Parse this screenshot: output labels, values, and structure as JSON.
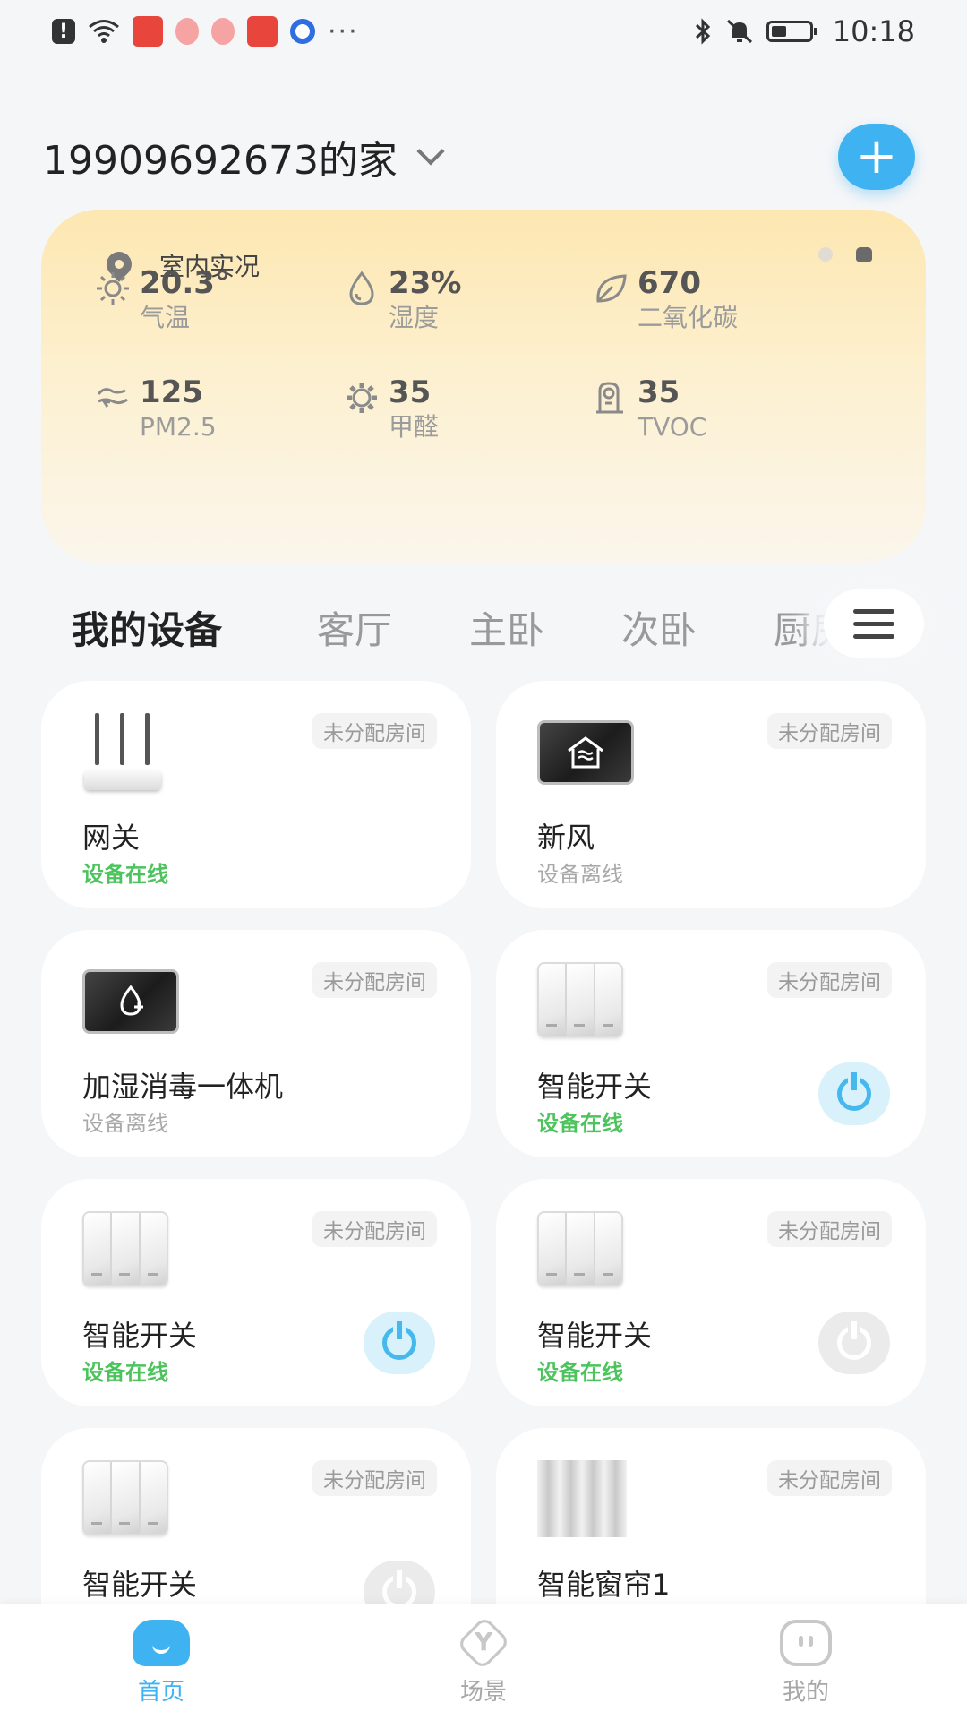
{
  "status_bar": {
    "time": "10:18",
    "more": "···",
    "icons": [
      "alert-icon",
      "wifi-icon",
      "app-icon",
      "app-icon",
      "app-icon",
      "app-icon",
      "app-icon",
      "bluetooth-icon",
      "mute-icon",
      "battery-icon"
    ]
  },
  "header": {
    "home_title": "19909692673的家",
    "add_label": "+"
  },
  "env": {
    "title": "室内实况",
    "metrics": [
      {
        "value": "20.3°",
        "label": "气温",
        "icon": "sun-icon"
      },
      {
        "value": "23%",
        "label": "湿度",
        "icon": "droplet-icon"
      },
      {
        "value": "670",
        "label": "二氧化碳",
        "icon": "leaf-icon"
      },
      {
        "value": "125",
        "label": "PM2.5",
        "icon": "wind-icon"
      },
      {
        "value": "35",
        "label": "甲醛",
        "icon": "gear-icon"
      },
      {
        "value": "35",
        "label": "TVOC",
        "icon": "sensor-icon"
      }
    ]
  },
  "tabs": [
    {
      "label": "我的设备",
      "active": true
    },
    {
      "label": "客厅"
    },
    {
      "label": "主卧"
    },
    {
      "label": "次卧"
    },
    {
      "label": "厨房"
    }
  ],
  "devices": [
    {
      "name": "网关",
      "status": "设备在线",
      "online": true,
      "room": "未分配房间",
      "image": "router",
      "power": null
    },
    {
      "name": "新风",
      "status": "设备离线",
      "online": false,
      "room": "未分配房间",
      "image": "fresh-air-panel",
      "power": null
    },
    {
      "name": "加湿消毒一体机",
      "status": "设备离线",
      "online": false,
      "room": "未分配房间",
      "image": "humidifier-panel",
      "power": null
    },
    {
      "name": "智能开关",
      "status": "设备在线",
      "online": true,
      "room": "未分配房间",
      "image": "switch",
      "power": "on"
    },
    {
      "name": "智能开关",
      "status": "设备在线",
      "online": true,
      "room": "未分配房间",
      "image": "switch",
      "power": "on"
    },
    {
      "name": "智能开关",
      "status": "设备在线",
      "online": true,
      "room": "未分配房间",
      "image": "switch",
      "power": "off"
    },
    {
      "name": "智能开关",
      "status": "",
      "online": true,
      "room": "未分配房间",
      "image": "switch",
      "power": "off"
    },
    {
      "name": "智能窗帘1",
      "status": "",
      "online": true,
      "room": "未分配房间",
      "image": "curtain",
      "power": null
    }
  ],
  "bottom_nav": [
    {
      "label": "首页",
      "active": true,
      "icon": "home-icon"
    },
    {
      "label": "场景",
      "active": false,
      "icon": "scene-icon"
    },
    {
      "label": "我的",
      "active": false,
      "icon": "profile-icon"
    }
  ],
  "colors": {
    "accent": "#3fb3f2",
    "online": "#4cc35d",
    "offline": "#a9a9a9"
  }
}
